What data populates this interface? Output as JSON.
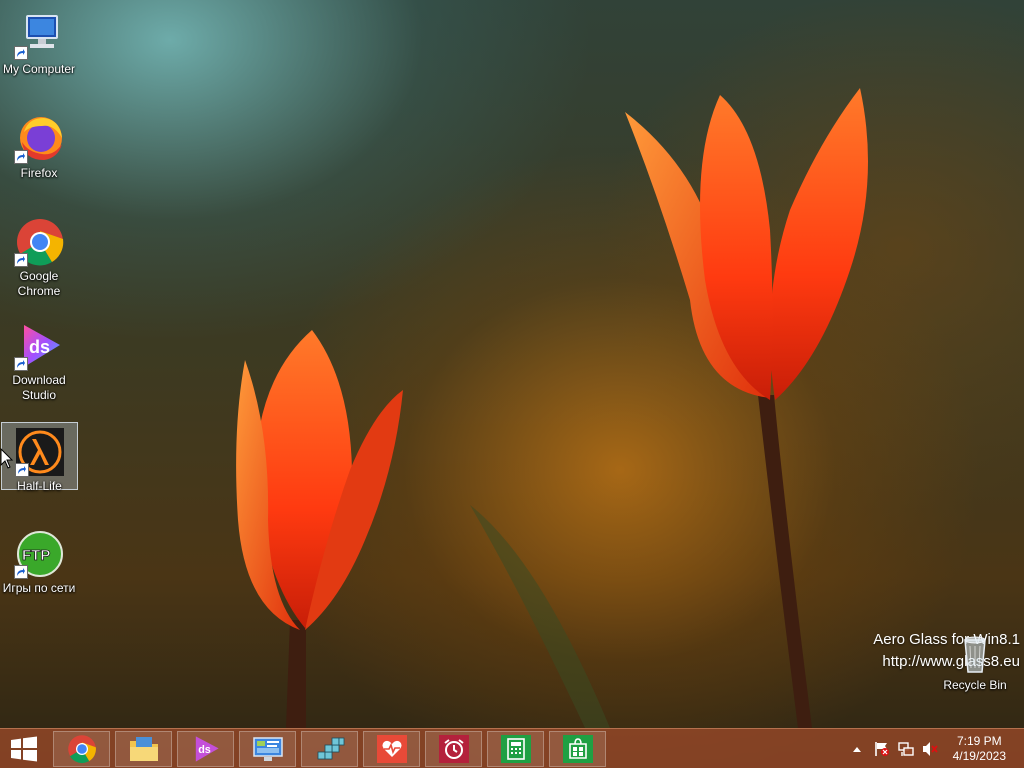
{
  "desktop": {
    "icons": [
      {
        "label": "My Computer",
        "icon": "computer-icon"
      },
      {
        "label": "Firefox",
        "icon": "firefox-icon"
      },
      {
        "label": "Google Chrome",
        "icon": "chrome-icon"
      },
      {
        "label": "Download Studio",
        "icon": "download-studio-icon"
      },
      {
        "label": "Half-Life",
        "icon": "half-life-icon",
        "selected": true
      },
      {
        "label": "Игры по сети",
        "icon": "ftp-icon"
      }
    ],
    "recycle_bin": {
      "label": "Recycle Bin",
      "icon": "recycle-bin-icon"
    },
    "watermark": {
      "line1": "Aero Glass for Win8.1",
      "line2": "http://www.glass8.eu"
    }
  },
  "taskbar": {
    "accent": "#96482a",
    "pinned": [
      {
        "name": "chrome",
        "icon": "chrome-icon"
      },
      {
        "name": "file-explorer",
        "icon": "folder-icon"
      },
      {
        "name": "download-studio",
        "icon": "download-studio-icon"
      },
      {
        "name": "control-panel",
        "icon": "control-panel-icon"
      },
      {
        "name": "blocks-app",
        "icon": "blocks-icon"
      },
      {
        "name": "health-app",
        "icon": "heart-monitor-icon"
      },
      {
        "name": "alarms-app",
        "icon": "alarm-clock-icon"
      },
      {
        "name": "calculator",
        "icon": "calculator-icon"
      },
      {
        "name": "store",
        "icon": "store-icon"
      }
    ],
    "tray": {
      "time": "7:19 PM",
      "date": "4/19/2023",
      "icons": [
        "chevron-up-icon",
        "flag-icon",
        "network-icon",
        "volume-muted-icon"
      ]
    }
  }
}
